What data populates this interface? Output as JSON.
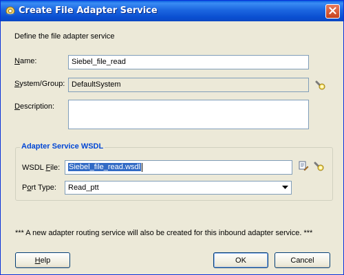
{
  "window": {
    "title": "Create File Adapter Service",
    "title_icon": "adapter-cog-icon",
    "close_icon": "close-icon"
  },
  "intro": "Define the file adapter service",
  "form": {
    "name": {
      "label": "Name:",
      "mnemonic": "N",
      "rest": "ame:",
      "value": "Siebel_file_read"
    },
    "system_group": {
      "label": "System/Group:",
      "mnemonic": "S",
      "rest": "ystem/Group:",
      "value": "DefaultSystem",
      "browse_icon": "flashlight-icon"
    },
    "description": {
      "label": "Description:",
      "mnemonic": "D",
      "rest": "escription:",
      "value": ""
    }
  },
  "wsdl_group": {
    "title": "Adapter Service WSDL",
    "wsdl_file": {
      "label": "WSDL File:",
      "pre": "WSDL ",
      "mnemonic": "F",
      "rest": "ile:",
      "value": "Siebel_file_read.wsdl",
      "edit_icon": "edit-wsdl-icon",
      "browse_icon": "flashlight-icon"
    },
    "port_type": {
      "label": "Port Type:",
      "pre": "P",
      "mnemonic": "o",
      "rest": "rt Type:",
      "value": "Read_ptt",
      "dropdown_icon": "chevron-down-icon"
    }
  },
  "note": "*** A new adapter routing service will also be created for this inbound adapter service. ***",
  "buttons": {
    "help": {
      "label": "Help",
      "mnemonic": "H",
      "rest": "elp"
    },
    "ok": {
      "label": "OK"
    },
    "cancel": {
      "label": "Cancel"
    }
  },
  "colors": {
    "titlebar": "#0a4fd1",
    "group_title": "#0046d5",
    "selection": "#316ac5"
  }
}
